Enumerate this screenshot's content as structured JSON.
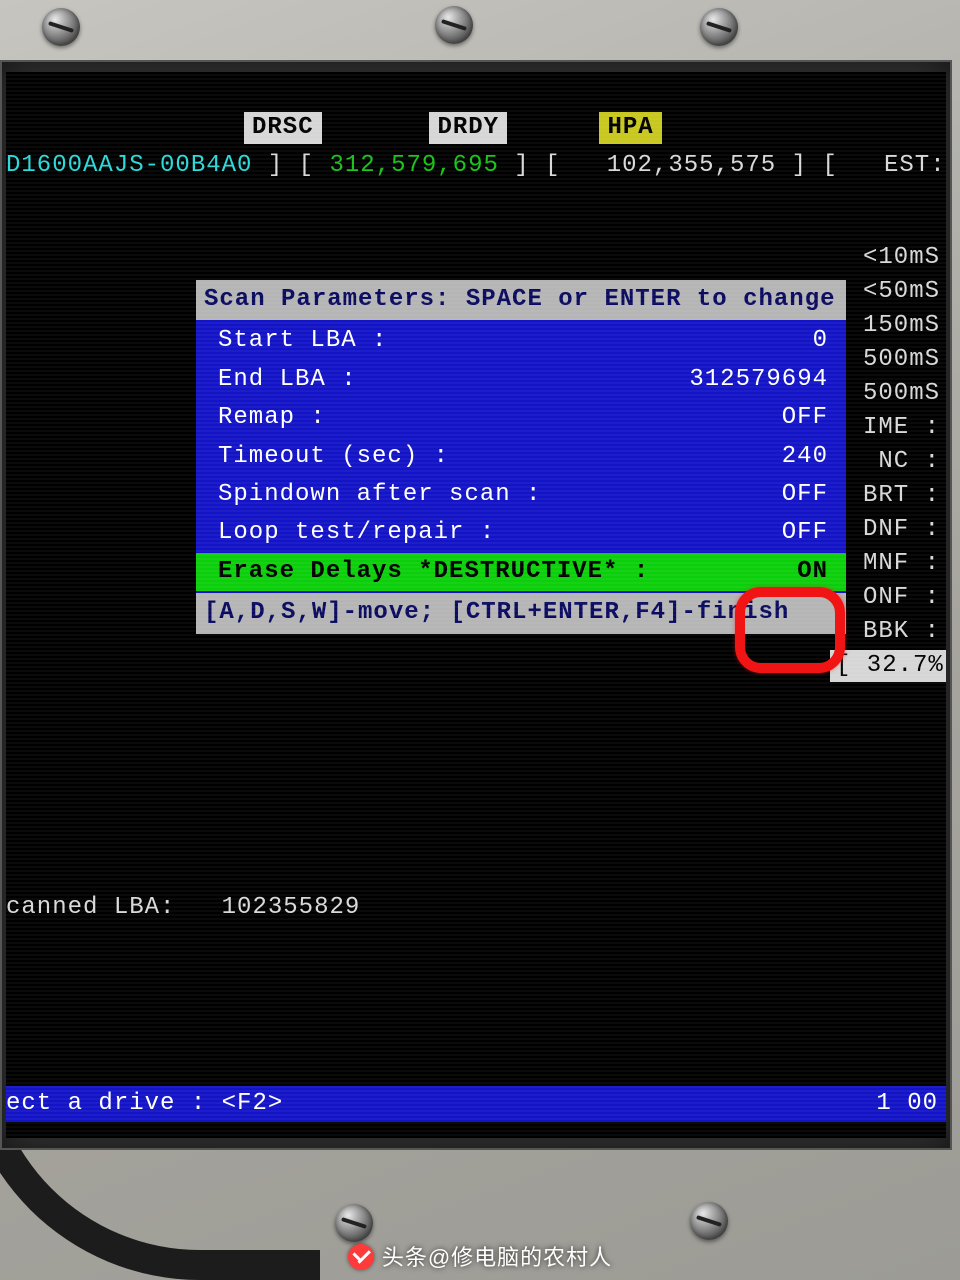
{
  "header": {
    "flags": {
      "drsc": "DRSC",
      "drdy": "DRDY",
      "hpa": "HPA"
    },
    "drive_model": "D1600AAJS-00B4A0",
    "lbas_total": "312,579,695",
    "lbas_done": "102,355,575",
    "est_label": "EST:"
  },
  "right_stats": {
    "lt10": "<10mS",
    "lt50": "<50mS",
    "lt150": "150mS",
    "lt500a": "500mS",
    "lt500b": "500mS",
    "ime": "IME :",
    "nc": "NC  :",
    "brt": "BRT :",
    "dnf": "DNF :",
    "mnf": "MNF :",
    "onf": "ONF :",
    "bbk": "* BBK :",
    "badpct": "[ 32.7% ]"
  },
  "dialog": {
    "title": "Scan Parameters: SPACE or ENTER to change",
    "rows": [
      {
        "label": "Start LBA :",
        "value": "0"
      },
      {
        "label": "End LBA :",
        "value": "312579694"
      },
      {
        "label": "Remap :",
        "value": "OFF"
      },
      {
        "label": "Timeout (sec) :",
        "value": "240"
      },
      {
        "label": "Spindown after scan :",
        "value": "OFF"
      },
      {
        "label": "Loop test/repair :",
        "value": "OFF"
      },
      {
        "label": "Erase Delays *DESTRUCTIVE* :",
        "value": "ON",
        "selected": true
      }
    ],
    "footer": "[A,D,S,W]-move; [CTRL+ENTER,F4]-finish"
  },
  "status": {
    "scanned_label": "canned LBA:",
    "scanned_value": "102355829"
  },
  "bottombar": {
    "left": "ect a drive : <F2>",
    "right": "1 00"
  },
  "watermark": "头条@修电脑的农村人"
}
